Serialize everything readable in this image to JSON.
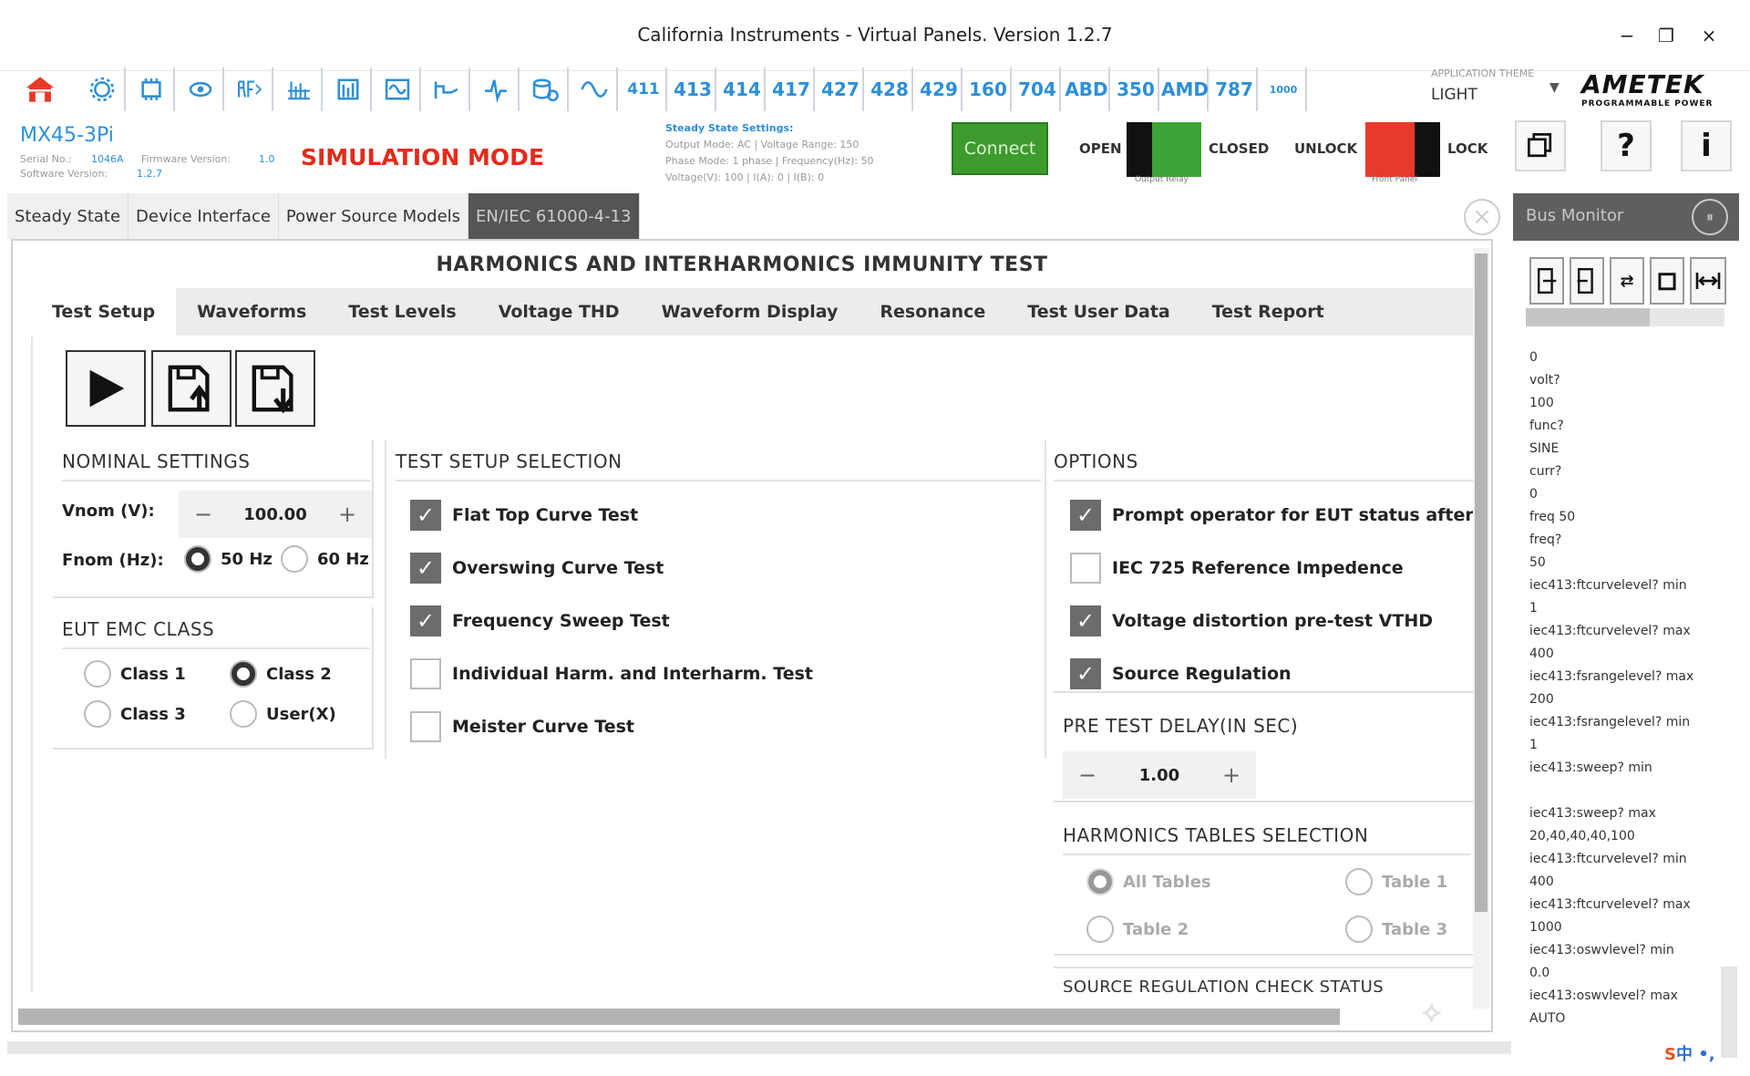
{
  "window": {
    "title": "California Instruments - Virtual Panels. Version 1.2.7",
    "minimize": "−",
    "maximize": "❐",
    "close": "×"
  },
  "toolbar": {
    "model_buttons": [
      "411",
      "413",
      "414",
      "417",
      "427",
      "428",
      "429",
      "160",
      "704",
      "ABD",
      "350",
      "AMD",
      "787",
      "1000"
    ],
    "app_theme_label": "APPLICATION THEME",
    "app_theme_value": "LIGHT",
    "brand": "AMETEK",
    "brand_sub": "PROGRAMMABLE POWER"
  },
  "device": {
    "model": "MX45-3Pi",
    "serial_label": "Serial No.:",
    "serial_value": "1046A",
    "firmware_label": "Firmware Version:",
    "firmware_value": "1.0",
    "software_label": "Software Version:",
    "software_value": "1.2.7",
    "mode": "SIMULATION MODE"
  },
  "steady_state": {
    "title": "Steady State Settings:",
    "line1": "Output Mode: AC | Voltage Range: 150",
    "line2": "Phase Mode: 1 phase | Frequency(Hz): 50",
    "line3": "Voltage(V): 100 | I(A): 0 | I(B): 0"
  },
  "controls": {
    "connect": "Connect",
    "open": "OPEN",
    "closed": "CLOSED",
    "output_relay": "Output Relay",
    "unlock": "UNLOCK",
    "lock": "LOCK",
    "front_panel": "Front Panel",
    "help": "?",
    "info": "i"
  },
  "main_tabs": [
    {
      "label": "Steady State",
      "active": false
    },
    {
      "label": "Device Interface",
      "active": false
    },
    {
      "label": "Power Source Models",
      "active": false
    },
    {
      "label": "EN/IEC 61000-4-13",
      "active": true
    }
  ],
  "test": {
    "title": "HARMONICS AND INTERHARMONICS IMMUNITY TEST",
    "sub_tabs": [
      {
        "label": "Test Setup",
        "active": true
      },
      {
        "label": "Waveforms",
        "active": false
      },
      {
        "label": "Test Levels",
        "active": false
      },
      {
        "label": "Voltage THD",
        "active": false
      },
      {
        "label": "Waveform Display",
        "active": false
      },
      {
        "label": "Resonance",
        "active": false
      },
      {
        "label": "Test User Data",
        "active": false
      },
      {
        "label": "Test Report",
        "active": false
      }
    ]
  },
  "nominal": {
    "title": "NOMINAL SETTINGS",
    "vnom_label": "Vnom (V):",
    "vnom_value": "100.00",
    "fnom_label": "Fnom (Hz):",
    "freq_options": [
      {
        "label": "50 Hz",
        "selected": true
      },
      {
        "label": "60 Hz",
        "selected": false
      }
    ]
  },
  "emc_class": {
    "title": "EUT EMC CLASS",
    "options": [
      {
        "label": "Class 1",
        "selected": false
      },
      {
        "label": "Class 2",
        "selected": true
      },
      {
        "label": "Class 3",
        "selected": false
      },
      {
        "label": "User(X)",
        "selected": false
      }
    ]
  },
  "setup_selection": {
    "title": "TEST SETUP SELECTION",
    "items": [
      {
        "label": "Flat Top Curve Test",
        "checked": true
      },
      {
        "label": "Overswing Curve Test",
        "checked": true
      },
      {
        "label": "Frequency Sweep Test",
        "checked": true
      },
      {
        "label": "Individual Harm. and Interharm. Test",
        "checked": false
      },
      {
        "label": "Meister Curve Test",
        "checked": false
      }
    ]
  },
  "options": {
    "title": "OPTIONS",
    "items": [
      {
        "label": "Prompt operator for EUT status after eac",
        "checked": true
      },
      {
        "label": "IEC 725 Reference Impedence",
        "checked": false
      },
      {
        "label": "Voltage distortion pre-test VTHD",
        "checked": true
      },
      {
        "label": "Source Regulation",
        "checked": true
      }
    ]
  },
  "pre_test_delay": {
    "title": "PRE TEST DELAY(IN SEC)",
    "value": "1.00"
  },
  "harmonics_tables": {
    "title": "HARMONICS TABLES SELECTION",
    "options": [
      {
        "label": "All Tables",
        "selected": true
      },
      {
        "label": "Table 1",
        "selected": false
      },
      {
        "label": "Table 2",
        "selected": false
      },
      {
        "label": "Table 3",
        "selected": false
      }
    ]
  },
  "source_regulation_title": "SOURCE REGULATION CHECK STATUS",
  "bus_monitor": {
    "title": "Bus Monitor",
    "log": [
      "0",
      "volt?",
      "100",
      "func?",
      "SINE",
      "curr?",
      "0",
      "freq 50",
      "freq?",
      "50",
      "iec413:ftcurvelevel? min",
      "1",
      "iec413:ftcurvelevel? max",
      "400",
      "iec413:fsrangelevel? max",
      "200",
      "iec413:fsrangelevel? min",
      "1",
      "iec413:sweep? min",
      "",
      "iec413:sweep? max",
      "20,40,40,40,100",
      "iec413:ftcurvelevel? min",
      "400",
      "iec413:ftcurvelevel? max",
      "1000",
      "iec413:oswvlevel? min",
      "0.0",
      "iec413:oswvlevel? max",
      "AUTO"
    ]
  },
  "ime": {
    "s": "S",
    "text": "中 •,"
  }
}
